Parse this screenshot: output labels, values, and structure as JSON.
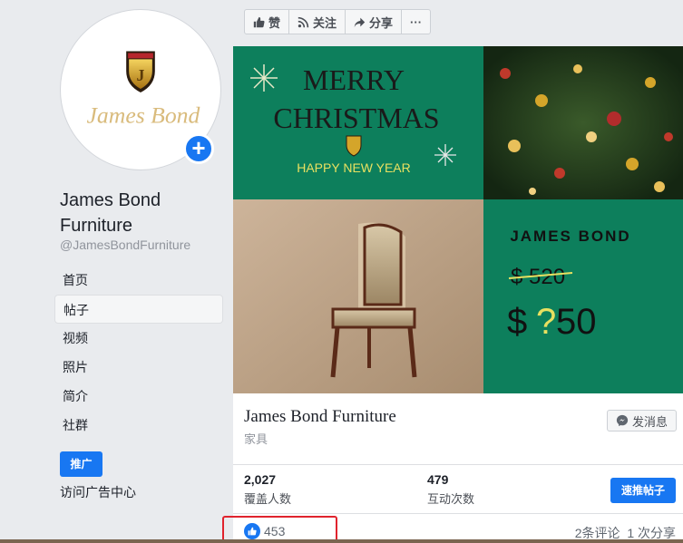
{
  "sidebar": {
    "page_name": "James Bond Furniture",
    "handle": "@JamesBondFurniture",
    "logo_text": "James Bond",
    "logo_initial": "J",
    "nav": [
      {
        "label": "首页",
        "active": false
      },
      {
        "label": "帖子",
        "active": true
      },
      {
        "label": "视频",
        "active": false
      },
      {
        "label": "照片",
        "active": false
      },
      {
        "label": "简介",
        "active": false
      },
      {
        "label": "社群",
        "active": false
      }
    ],
    "promote_label": "推广",
    "ads_center_label": "访问广告中心"
  },
  "toolbar": {
    "like_label": "赞",
    "follow_label": "关注",
    "share_label": "分享",
    "more_label": "···"
  },
  "post_image": {
    "line1": "MERRY",
    "line2": "CHRISTMAS",
    "line3": "HAPPY NEW YEAR",
    "brand": "JAMES BOND",
    "old_price": "$ 520",
    "new_price_symbol": "$",
    "new_price_unknown": "?",
    "new_price_digits": "50"
  },
  "business": {
    "name": "James Bond Furniture",
    "category": "家具",
    "message_label": "发消息"
  },
  "stats": {
    "reach_value": "2,027",
    "reach_label": "覆盖人数",
    "engagement_value": "479",
    "engagement_label": "互动次数",
    "boost_label": "速推帖子"
  },
  "engagement": {
    "likes": "453",
    "comments_shares": "2条评论  1 次分享"
  },
  "colors": {
    "brand_blue": "#1877f2",
    "green_panel": "#0d7f5c",
    "gold": "#d4a52a",
    "highlight_red": "#e0232d"
  }
}
